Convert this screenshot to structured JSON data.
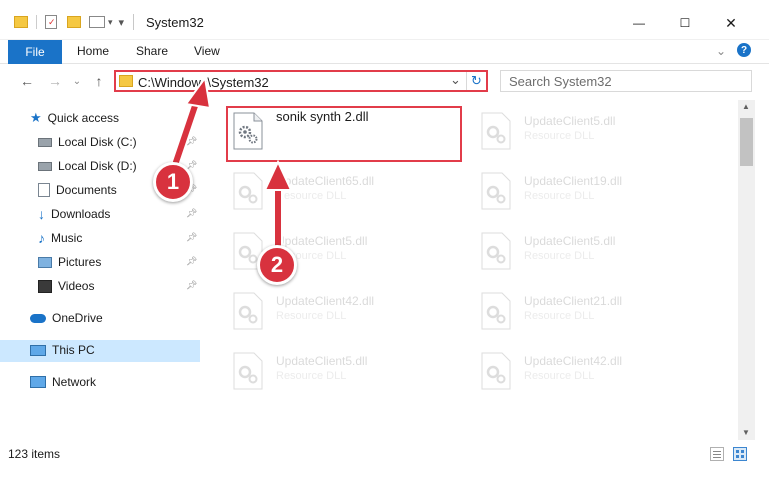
{
  "window": {
    "title": "System32",
    "minimize_glyph": "—",
    "maximize_glyph": "☐",
    "close_glyph": "✕"
  },
  "ribbon": {
    "tabs": [
      "File",
      "Home",
      "Share",
      "View"
    ],
    "expand_glyph": "⌄",
    "help_glyph": "?"
  },
  "address": {
    "path": "C:\\Windows\\System32",
    "search_placeholder": "Search System32",
    "dropdown_glyph": "⌄",
    "refresh_glyph": "↻"
  },
  "nav": {
    "back_glyph": "←",
    "forward_glyph": "→",
    "recent_glyph": "⌄",
    "up_glyph": "↑",
    "items": [
      {
        "label": "Quick access",
        "icon": "star-icon"
      },
      {
        "label": "Local Disk (C:)",
        "icon": "drive-icon"
      },
      {
        "label": "Local Disk (D:)",
        "icon": "drive-icon"
      },
      {
        "label": "Documents",
        "icon": "documents-icon"
      },
      {
        "label": "Downloads",
        "icon": "download-icon"
      },
      {
        "label": "Music",
        "icon": "music-icon"
      },
      {
        "label": "Pictures",
        "icon": "pictures-icon"
      },
      {
        "label": "Videos",
        "icon": "videos-icon"
      },
      {
        "label": "OneDrive",
        "icon": "cloud-icon"
      },
      {
        "label": "This PC",
        "icon": "computer-icon"
      },
      {
        "label": "Network",
        "icon": "network-icon"
      }
    ]
  },
  "files": [
    {
      "name": "sonik synth 2.dll",
      "type": ""
    },
    {
      "name": "UpdateClient5.dll",
      "type": "Resource DLL"
    },
    {
      "name": "UpdateClient65.dll",
      "type": "Resource DLL"
    },
    {
      "name": "UpdateClient19.dll",
      "type": "Resource DLL"
    },
    {
      "name": "UpdateClient5.dll",
      "type": "Resource DLL"
    },
    {
      "name": "UpdateClient5.dll",
      "type": "Resource DLL"
    },
    {
      "name": "UpdateClient42.dll",
      "type": "Resource DLL"
    },
    {
      "name": "UpdateClient21.dll",
      "type": "Resource DLL"
    },
    {
      "name": "UpdateClient5.dll",
      "type": "Resource DLL"
    },
    {
      "name": "UpdateClient42.dll",
      "type": "Resource DLL"
    }
  ],
  "status": {
    "item_count": "123 items"
  },
  "callouts": [
    "1",
    "2"
  ],
  "colors": {
    "accent": "#1a73c8",
    "highlight": "#e23c4a",
    "selected_nav": "#cce8ff"
  }
}
